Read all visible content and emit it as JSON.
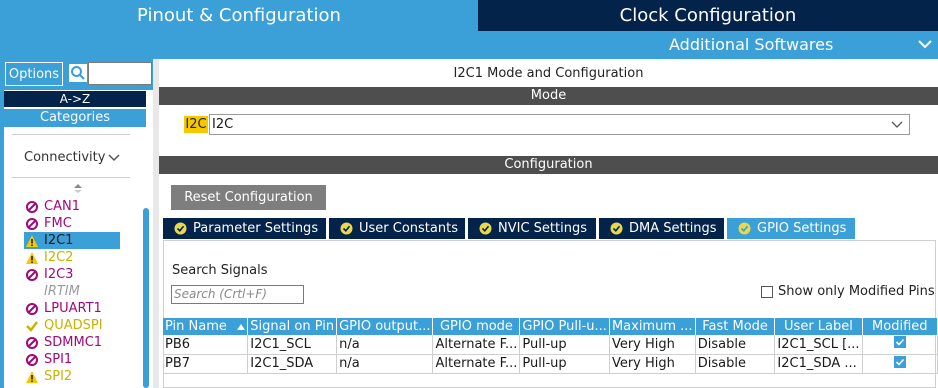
{
  "tabs": {
    "pinout": "Pinout & Configuration",
    "clock": "Clock Configuration",
    "additional": "Additional Softwares"
  },
  "left": {
    "options_label": "Options",
    "search_value": "",
    "az_label": "A->Z",
    "categories_label": "Categories",
    "connectivity_label": "Connectivity",
    "peripherals": [
      {
        "name": "CAN1",
        "status": "disabled"
      },
      {
        "name": "FMC",
        "status": "disabled"
      },
      {
        "name": "I2C1",
        "status": "warning",
        "selected": true
      },
      {
        "name": "I2C2",
        "status": "warning"
      },
      {
        "name": "I2C3",
        "status": "disabled"
      },
      {
        "name": "IRTIM",
        "status": "unavailable"
      },
      {
        "name": "LPUART1",
        "status": "disabled"
      },
      {
        "name": "QUADSPI",
        "status": "ok"
      },
      {
        "name": "SDMMC1",
        "status": "disabled"
      },
      {
        "name": "SPI1",
        "status": "disabled"
      },
      {
        "name": "SPI2",
        "status": "warning"
      }
    ]
  },
  "main": {
    "title": "I2C1 Mode and Configuration",
    "mode_header": "Mode",
    "i2c_tag": "I2C",
    "i2c_value": "I2C",
    "config_header": "Configuration",
    "reset_button": "Reset Configuration",
    "subtabs": [
      {
        "label": "Parameter Settings",
        "active": false
      },
      {
        "label": "User Constants",
        "active": false
      },
      {
        "label": "NVIC Settings",
        "active": false
      },
      {
        "label": "DMA Settings",
        "active": false
      },
      {
        "label": "GPIO Settings",
        "active": true
      }
    ],
    "search_signals_label": "Search Signals",
    "search_placeholder": "Search (Crtl+F)",
    "only_modified_label": "Show only Modified Pins",
    "table": {
      "columns": [
        "Pin Name",
        "Signal on Pin",
        "GPIO output...",
        "GPIO mode",
        "GPIO Pull-u...",
        "Maximum ...",
        "Fast Mode",
        "User Label",
        "Modified"
      ],
      "rows": [
        [
          "PB6",
          "I2C1_SCL",
          "n/a",
          "Alternate F...",
          "Pull-up",
          "Very High",
          "Disable",
          "I2C1_SCL [...",
          "checked"
        ],
        [
          "PB7",
          "I2C1_SDA",
          "n/a",
          "Alternate F...",
          "Pull-up",
          "Very High",
          "Disable",
          "I2C1_SDA ...",
          "checked"
        ]
      ]
    }
  },
  "colors": {
    "accent_blue": "#3b9fd8",
    "navy": "#03234b",
    "gray_bar": "#4e4e4e",
    "highlight_yellow": "#f6c800",
    "disabled_magenta": "#a1087c"
  }
}
